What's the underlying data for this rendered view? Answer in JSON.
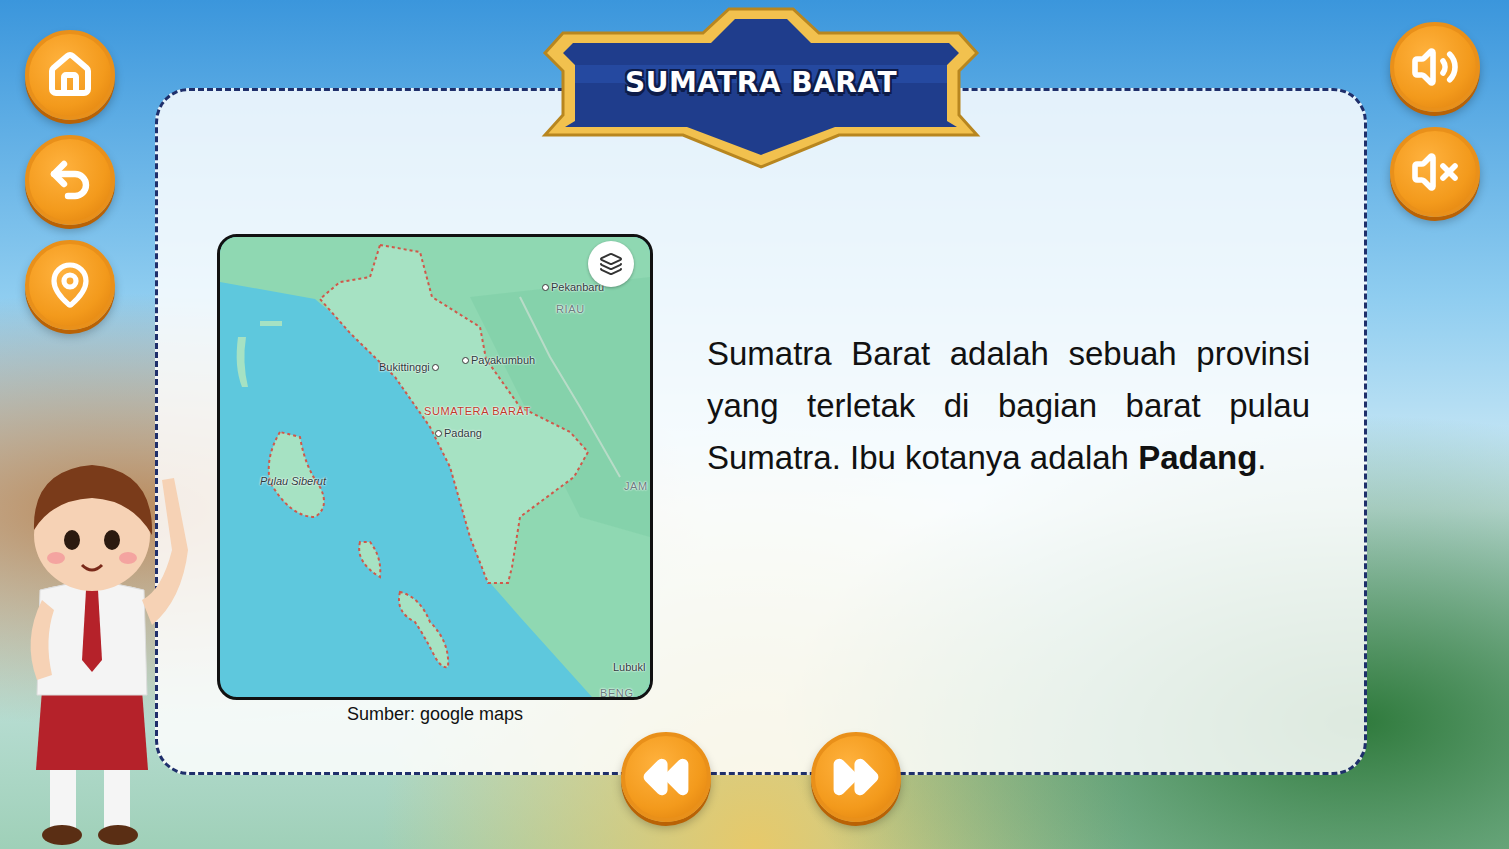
{
  "title": "SUMATRA BARAT",
  "description": [
    {
      "text": "Sumatra Barat adalah sebuah provinsi yang terletak di bagian barat pulau Sumatra. Ibu kotanya adalah ",
      "bold": false
    },
    {
      "text": "Padang",
      "bold": true
    },
    {
      "text": ".",
      "bold": false
    }
  ],
  "map": {
    "labels": [
      {
        "text": "Pekanbaru",
        "kind": "city"
      },
      {
        "text": "RIAU",
        "kind": "region"
      },
      {
        "text": "Bukittinggi",
        "kind": "city-right"
      },
      {
        "text": "Payakumbuh",
        "kind": "city"
      },
      {
        "text": "SUMATERA BARAT",
        "kind": "province"
      },
      {
        "text": "Padang",
        "kind": "city"
      },
      {
        "text": "Pulau Siberut",
        "kind": "island"
      },
      {
        "text": "JAM",
        "kind": "region"
      },
      {
        "text": "Lubukl",
        "kind": "plain"
      },
      {
        "text": "BENG",
        "kind": "region"
      }
    ],
    "caption": "Sumber: google maps"
  }
}
